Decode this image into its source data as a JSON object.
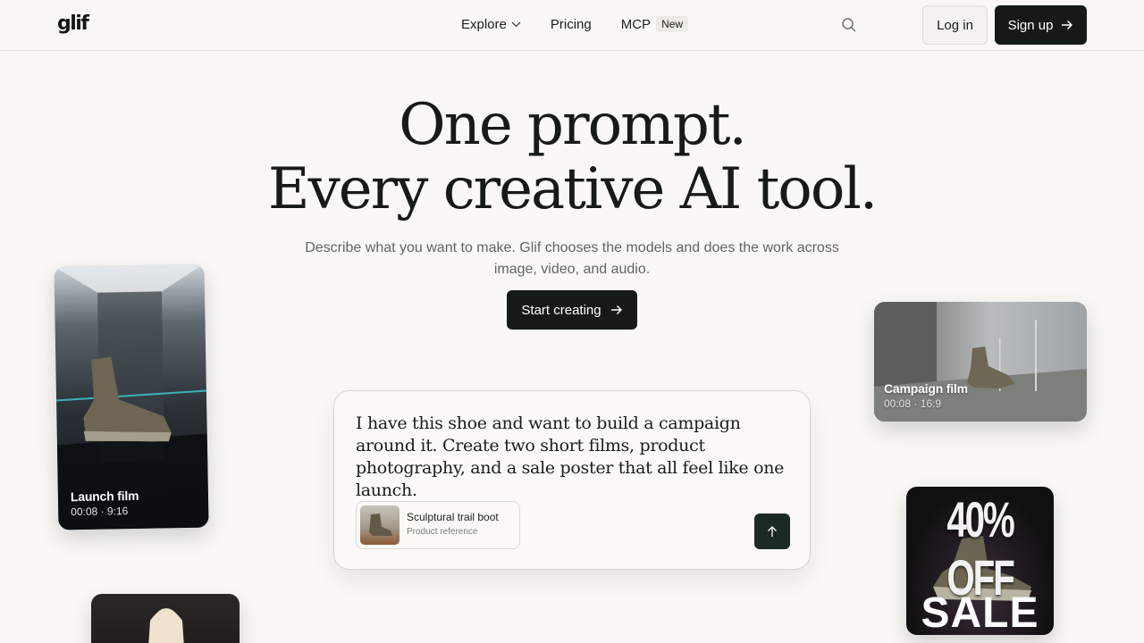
{
  "header": {
    "logo": "glif",
    "nav": [
      {
        "label": "Explore",
        "icon": "chevron-down-icon"
      },
      {
        "label": "Pricing"
      },
      {
        "label": "MCP",
        "badge": "New"
      }
    ],
    "search_icon": "search-icon",
    "login_label": "Log in",
    "signup_label": "Sign up"
  },
  "hero": {
    "title_line1": "One prompt.",
    "title_line2": "Every creative AI tool.",
    "subtitle": "Describe what you want to make. Glif chooses the models and does the work across image, video, and audio.",
    "cta_label": "Start creating"
  },
  "cards": {
    "launch": {
      "title": "Launch film",
      "meta": "00:08 · 9:16"
    },
    "campaign": {
      "title": "Campaign film",
      "meta": "00:08 · 16:9"
    },
    "sale": {
      "top_text": "40% OFF",
      "bottom_text": "SALE"
    }
  },
  "prompt": {
    "text": "I have this shoe and want to build a campaign around it. Create two short films, product photography, and a sale poster that all feel like one launch.",
    "attachment": {
      "title": "Sculptural trail boot",
      "subtitle": "Product reference"
    },
    "send_icon": "arrow-up-icon"
  },
  "colors": {
    "background": "#f9f8f5",
    "dark_button": "#161a17",
    "send_button": "#1d2a23",
    "text_muted": "#62655f"
  }
}
